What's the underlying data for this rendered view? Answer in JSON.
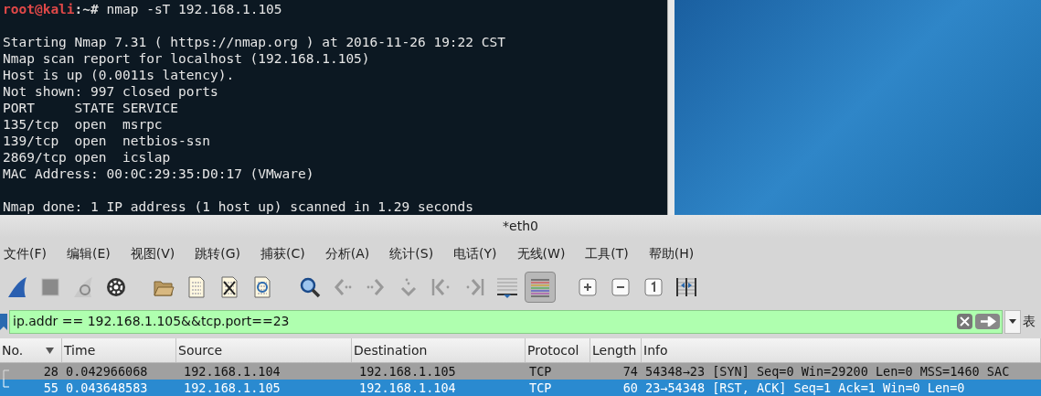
{
  "terminal": {
    "prompt_user": "root@kali",
    "prompt_path": ":~#",
    "command": "nmap -sT 192.168.1.105",
    "output_blocks": [
      {
        "lines": [
          "Starting Nmap 7.31 ( https://nmap.org ) at 2016-11-26 19:22 CST",
          "Nmap scan report for localhost (192.168.1.105)",
          "Host is up (0.0011s latency).",
          "Not shown: 997 closed ports",
          "PORT     STATE SERVICE",
          "135/tcp  open  msrpc",
          "139/tcp  open  netbios-ssn",
          "2869/tcp open  icslap",
          "MAC Address: 00:0C:29:35:D0:17 (VMware)"
        ]
      },
      {
        "lines": [
          "Nmap done: 1 IP address (1 host up) scanned in 1.29 seconds"
        ]
      }
    ]
  },
  "wireshark": {
    "title": "*eth0",
    "menu": [
      "文件(F)",
      "编辑(E)",
      "视图(V)",
      "跳转(G)",
      "捕获(C)",
      "分析(A)",
      "统计(S)",
      "电话(Y)",
      "无线(W)",
      "工具(T)",
      "帮助(H)"
    ],
    "toolbar": [
      {
        "kind": "start",
        "selected": false
      },
      {
        "kind": "stop",
        "selected": false
      },
      {
        "kind": "restart",
        "selected": false
      },
      {
        "kind": "options",
        "selected": false
      },
      {
        "kind": "sep"
      },
      {
        "kind": "open",
        "selected": false
      },
      {
        "kind": "save",
        "selected": false
      },
      {
        "kind": "close",
        "selected": false
      },
      {
        "kind": "reload",
        "selected": false
      },
      {
        "kind": "sep"
      },
      {
        "kind": "find",
        "selected": false
      },
      {
        "kind": "back",
        "selected": false
      },
      {
        "kind": "forward",
        "selected": false
      },
      {
        "kind": "goto",
        "selected": false
      },
      {
        "kind": "first",
        "selected": false
      },
      {
        "kind": "last",
        "selected": false
      },
      {
        "kind": "autoscroll",
        "selected": false
      },
      {
        "kind": "colorize",
        "selected": true
      },
      {
        "kind": "sep"
      },
      {
        "kind": "zoom_in",
        "selected": false
      },
      {
        "kind": "zoom_out",
        "selected": false
      },
      {
        "kind": "zoom_normal",
        "selected": false
      },
      {
        "kind": "resize",
        "selected": false
      }
    ],
    "filter": {
      "value": "ip.addr == 192.168.1.105&&tcp.port==23",
      "expression_label": "表"
    },
    "columns": [
      "No.",
      "Time",
      "Source",
      "Destination",
      "Protocol",
      "Length",
      "Info"
    ],
    "rows": [
      {
        "selected": false,
        "kind": "first",
        "cells": [
          "28",
          "0.042966068",
          "192.168.1.104",
          "192.168.1.105",
          "TCP",
          "74",
          "54348→23 [SYN] Seq=0 Win=29200 Len=0 MSS=1460 SAC"
        ]
      },
      {
        "selected": true,
        "kind": "last",
        "cells": [
          "55",
          "0.043648583",
          "192.168.1.105",
          "192.168.1.104",
          "TCP",
          "60",
          "23→54348 [RST, ACK] Seq=1 Ack=1 Win=0 Len=0"
        ]
      }
    ]
  }
}
